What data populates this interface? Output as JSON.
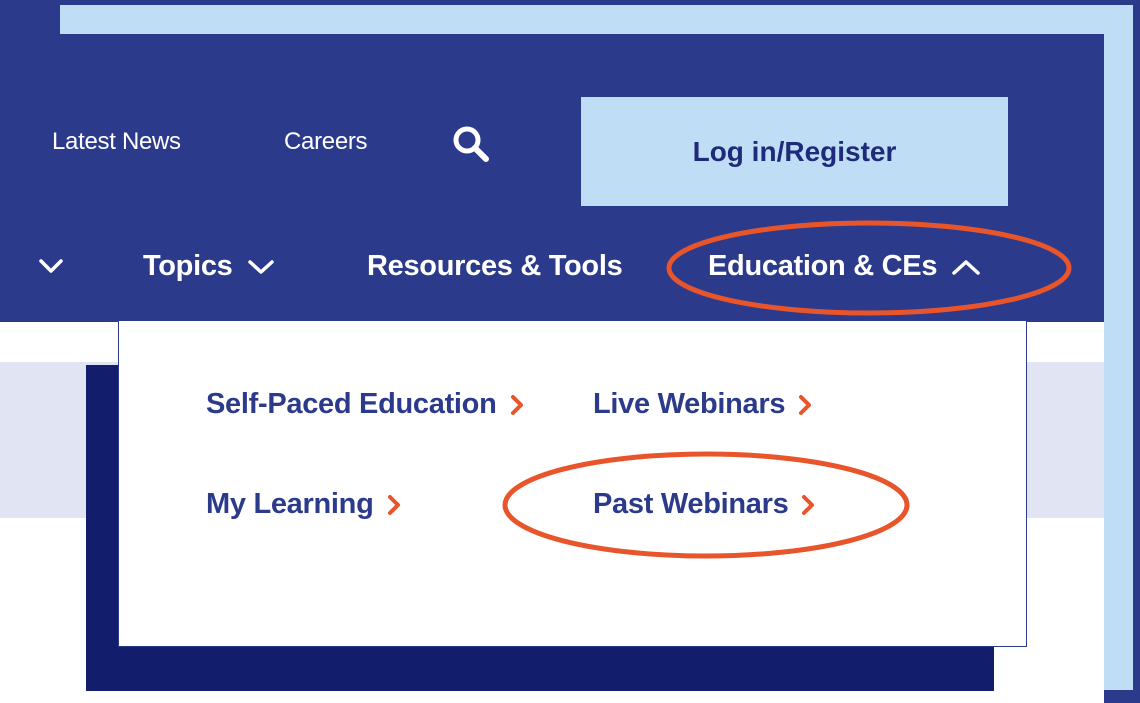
{
  "header": {
    "top_links": [
      "Latest News",
      "Careers"
    ],
    "search_icon": "search-icon",
    "login_label": "Log in/Register"
  },
  "nav": {
    "items": [
      {
        "label": "Topics",
        "icon": "chevron-down-icon"
      },
      {
        "label": "Resources & Tools"
      },
      {
        "label": "Education & CEs",
        "icon": "chevron-up-icon",
        "expanded": true
      }
    ]
  },
  "dropdown": {
    "links": [
      {
        "label": "Self-Paced Education",
        "icon": "chevron-right-icon"
      },
      {
        "label": "Live Webinars",
        "icon": "chevron-right-icon"
      },
      {
        "label": "My Learning",
        "icon": "chevron-right-icon"
      },
      {
        "label": "Past Webinars",
        "icon": "chevron-right-icon"
      }
    ]
  },
  "colors": {
    "header_bg": "#2c3a8c",
    "light_blue": "#c0ddf6",
    "accent_orange": "#e8552b",
    "link_text": "#2c3a8c",
    "navy_block": "#121d6b"
  }
}
